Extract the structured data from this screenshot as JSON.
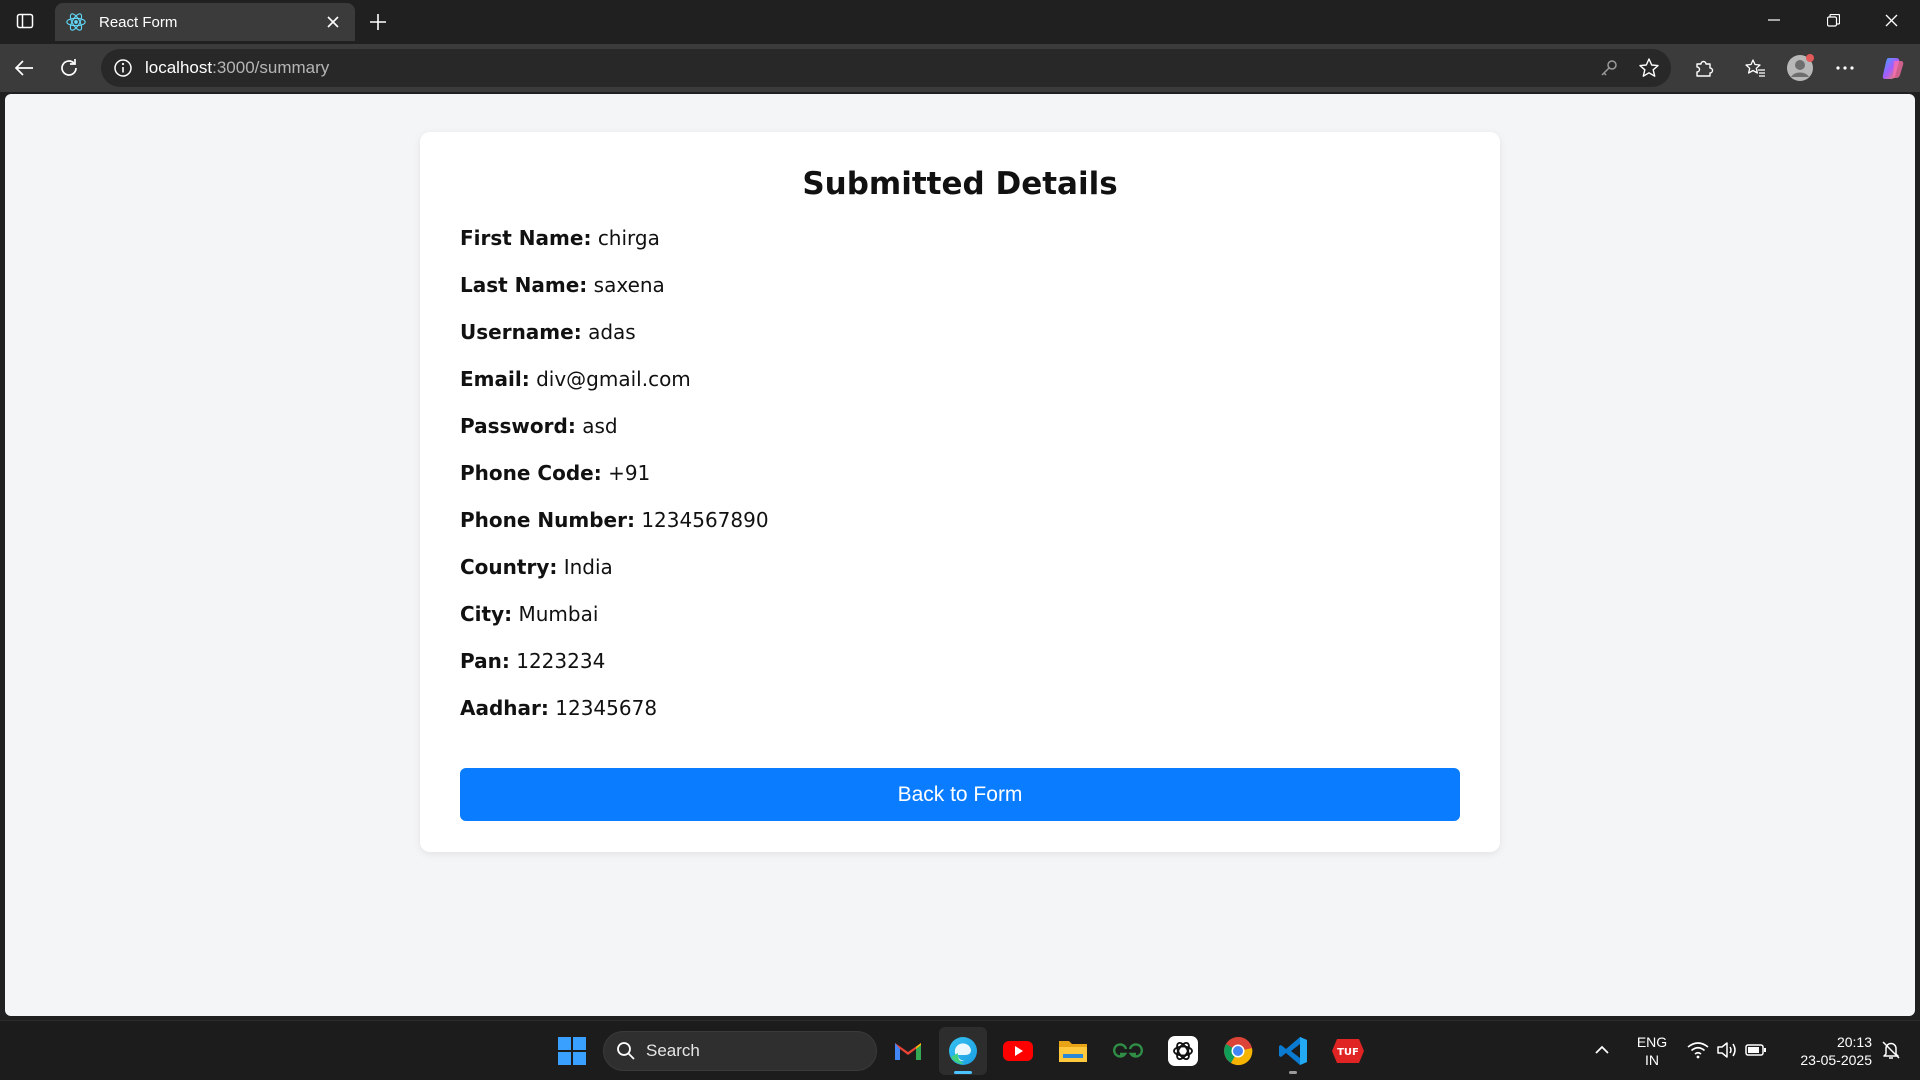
{
  "browser": {
    "tab_title": "React Form",
    "url_host": "localhost",
    "url_path": ":3000/summary"
  },
  "page": {
    "title": "Submitted Details",
    "fields": [
      {
        "label": "First Name:",
        "value": "chirga"
      },
      {
        "label": "Last Name:",
        "value": "saxena"
      },
      {
        "label": "Username:",
        "value": "adas"
      },
      {
        "label": "Email:",
        "value": "div@gmail.com"
      },
      {
        "label": "Password:",
        "value": "asd"
      },
      {
        "label": "Phone Code:",
        "value": "+91"
      },
      {
        "label": "Phone Number:",
        "value": "1234567890"
      },
      {
        "label": "Country:",
        "value": "India"
      },
      {
        "label": "City:",
        "value": "Mumbai"
      },
      {
        "label": "Pan:",
        "value": "1223234"
      },
      {
        "label": "Aadhar:",
        "value": "12345678"
      }
    ],
    "back_button_label": "Back to Form"
  },
  "taskbar": {
    "search_label": "Search",
    "language_top": "ENG",
    "language_bottom": "IN",
    "time": "20:13",
    "date": "23-05-2025",
    "tuf_label": "TUF"
  },
  "colors": {
    "accent": "#0a7cff",
    "page_bg": "#f4f5f7",
    "card_bg": "#ffffff",
    "chrome_bg": "#202020",
    "toolbar_bg": "#3b3b3b"
  }
}
